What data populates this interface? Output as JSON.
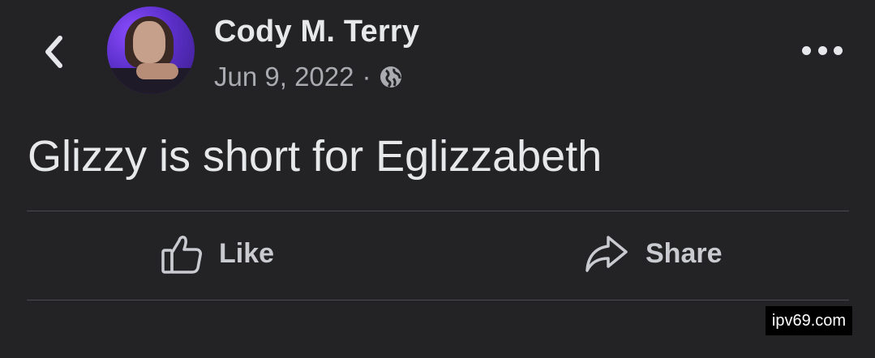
{
  "header": {
    "back_icon": "chevron-left-icon",
    "more_icon": "ellipsis-horizontal-icon"
  },
  "post": {
    "author": "Cody M. Terry",
    "date": "Jun 9, 2022",
    "separator": "·",
    "audience_icon": "globe-icon",
    "text": "Glizzy is short for Eglizzabeth"
  },
  "actions": {
    "like_label": "Like",
    "like_icon": "thumbs-up-icon",
    "share_label": "Share",
    "share_icon": "share-arrow-icon"
  },
  "watermark": {
    "text": "ipv69.com"
  },
  "colors": {
    "background": "#232326",
    "text_primary": "#e7e8ea",
    "text_secondary": "#a9abb0",
    "divider": "#494a4f",
    "avatar_accent": "#7b3ff2"
  }
}
